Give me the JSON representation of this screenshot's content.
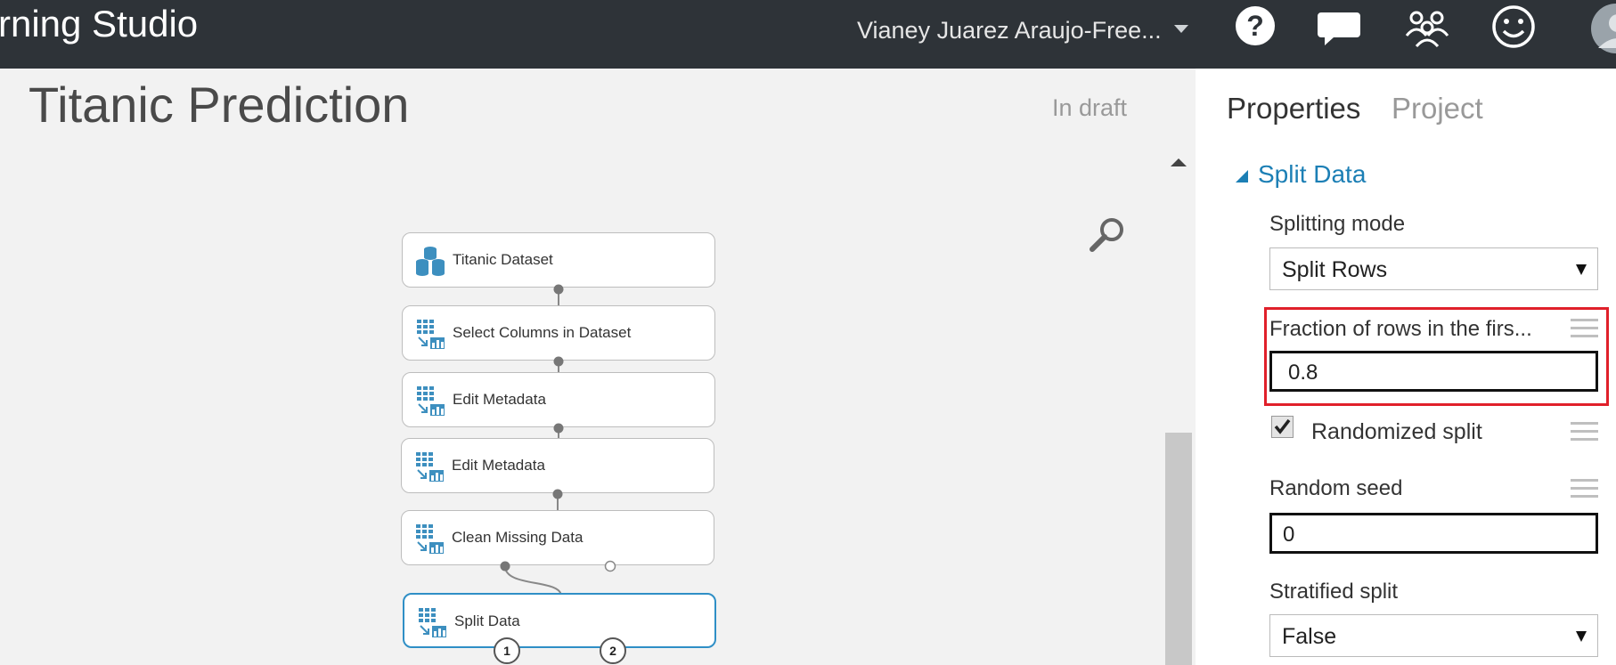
{
  "topbar": {
    "app_title": "rning Studio",
    "user_name": "Vianey Juarez Araujo-Free...",
    "icons": [
      "help-icon",
      "chat-icon",
      "community-icon",
      "feedback-smiley-icon",
      "avatar"
    ]
  },
  "experiment": {
    "title": "Titanic Prediction",
    "status": "In draft"
  },
  "modules": [
    {
      "label": "Titanic Dataset",
      "icon": "dataset-icon"
    },
    {
      "label": "Select Columns in Dataset",
      "icon": "module-icon"
    },
    {
      "label": "Edit Metadata",
      "icon": "module-icon"
    },
    {
      "label": "Edit Metadata",
      "icon": "module-icon"
    },
    {
      "label": "Clean Missing Data",
      "icon": "module-icon"
    },
    {
      "label": "Split Data",
      "icon": "module-icon",
      "selected": true
    }
  ],
  "split_ports": [
    "1",
    "2"
  ],
  "properties": {
    "tabs": [
      "Properties",
      "Project"
    ],
    "section_title": "Split Data",
    "splitting_mode_label": "Splitting mode",
    "splitting_mode_value": "Split Rows",
    "fraction_label": "Fraction of rows in the firs...",
    "fraction_value": "0.8",
    "randomized_label": "Randomized split",
    "randomized_checked": true,
    "seed_label": "Random seed",
    "seed_value": "0",
    "stratified_label": "Stratified split",
    "stratified_value": "False"
  },
  "colors": {
    "topbar": "#2e3338",
    "accent": "#1c7fb5",
    "highlight": "#e0202a",
    "selected_module_border": "#2f8fc6"
  }
}
